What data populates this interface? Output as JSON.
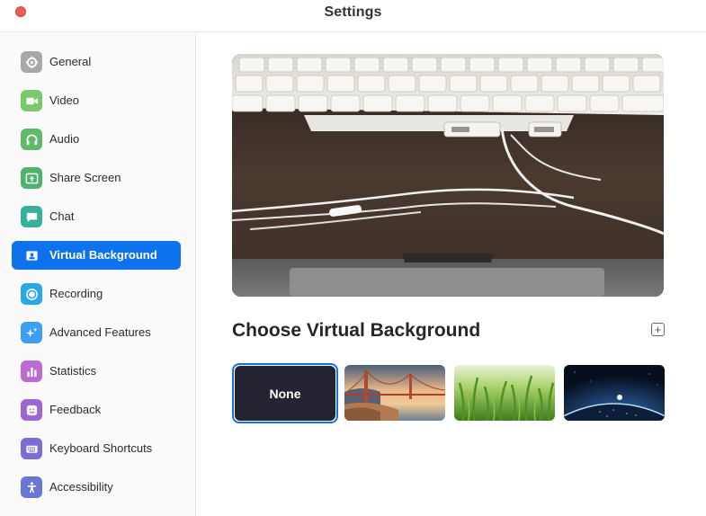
{
  "window": {
    "title": "Settings"
  },
  "sidebar": {
    "items": [
      {
        "label": "General",
        "icon": "gear-icon",
        "color": "#9e9e9e"
      },
      {
        "label": "Video",
        "icon": "video-camera-icon",
        "color": "#7ac36a"
      },
      {
        "label": "Audio",
        "icon": "headphones-icon",
        "color": "#6abf6a"
      },
      {
        "label": "Share Screen",
        "icon": "share-screen-icon",
        "color": "#4cae6b"
      },
      {
        "label": "Chat",
        "icon": "chat-bubble-icon",
        "color": "#32b29a"
      },
      {
        "label": "Virtual Background",
        "icon": "person-portrait-icon",
        "color": "#0e72ed",
        "active": true
      },
      {
        "label": "Recording",
        "icon": "record-icon",
        "color": "#2aa3e8"
      },
      {
        "label": "Advanced Features",
        "icon": "sparkles-icon",
        "color": "#3a9ff0"
      },
      {
        "label": "Statistics",
        "icon": "bar-chart-icon",
        "color": "#b768cf"
      },
      {
        "label": "Feedback",
        "icon": "smiley-icon",
        "color": "#9b63cf"
      },
      {
        "label": "Keyboard Shortcuts",
        "icon": "keyboard-icon",
        "color": "#7a6bd0"
      },
      {
        "label": "Accessibility",
        "icon": "accessibility-icon",
        "color": "#6674d4"
      }
    ]
  },
  "main": {
    "section_title": "Choose Virtual Background",
    "add_button_symbol": "+",
    "backgrounds": [
      {
        "label": "None",
        "selected": true
      },
      {
        "label": "Golden Gate Bridge",
        "kind": "bridge"
      },
      {
        "label": "Grass",
        "kind": "grass"
      },
      {
        "label": "Earth from space",
        "kind": "earth"
      }
    ]
  },
  "colors": {
    "accent": "#0e72ed",
    "close_button": "#ed5c57"
  }
}
